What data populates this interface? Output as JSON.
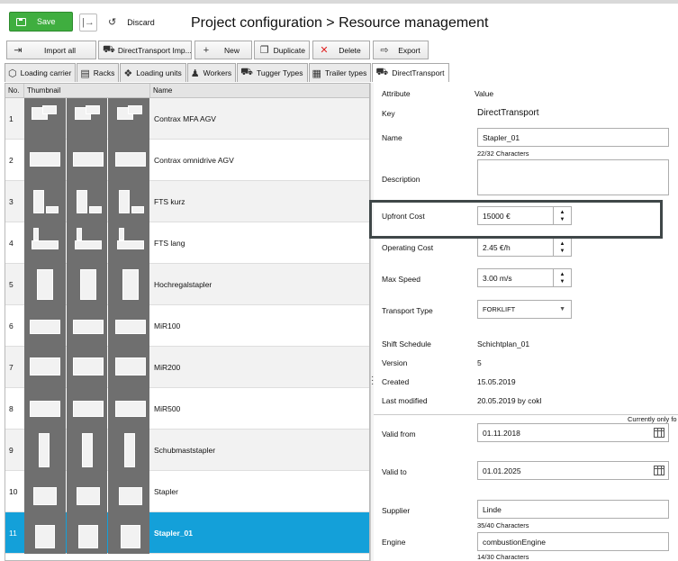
{
  "header": {
    "save_label": "Save",
    "discard_label": "Discard",
    "title": "Project configuration  >  Resource management"
  },
  "toolbar": {
    "import_all": "Import all",
    "direct_import": "DirectTransport Imp...",
    "new": "New",
    "duplicate": "Duplicate",
    "delete": "Delete",
    "export": "Export"
  },
  "tabs": [
    {
      "label": "Loading carrier"
    },
    {
      "label": "Racks"
    },
    {
      "label": "Loading units"
    },
    {
      "label": "Workers"
    },
    {
      "label": "Tugger Types"
    },
    {
      "label": "Trailer types"
    },
    {
      "label": "DirectTransport"
    }
  ],
  "table": {
    "col_no": "No.",
    "col_thumb": "Thumbnail",
    "col_name": "Name",
    "rows": [
      {
        "no": "1",
        "name": "Contrax MFA AGV"
      },
      {
        "no": "2",
        "name": "Contrax omnidrive AGV"
      },
      {
        "no": "3",
        "name": "FTS kurz"
      },
      {
        "no": "4",
        "name": "FTS lang"
      },
      {
        "no": "5",
        "name": "Hochregalstapler"
      },
      {
        "no": "6",
        "name": "MiR100"
      },
      {
        "no": "7",
        "name": "MiR200"
      },
      {
        "no": "8",
        "name": "MiR500"
      },
      {
        "no": "9",
        "name": "Schubmaststapler"
      },
      {
        "no": "10",
        "name": "Stapler"
      },
      {
        "no": "11",
        "name": "Stapler_01"
      }
    ],
    "selected_index": 10
  },
  "properties": {
    "col_attribute": "Attribute",
    "col_value": "Value",
    "key_label": "Key",
    "key_value": "DirectTransport",
    "name_label": "Name",
    "name_value": "Stapler_01",
    "name_counter": "22/32 Characters",
    "description_label": "Description",
    "description_value": "",
    "upfront_label": "Upfront Cost",
    "upfront_value": "15000 €",
    "operating_label": "Operating Cost",
    "operating_value": "2.45 €/h",
    "speed_label": "Max Speed",
    "speed_value": "3.00 m/s",
    "transport_label": "Transport Type",
    "transport_value": "FORKLIFT",
    "shift_label": "Shift Schedule",
    "shift_value": "Schichtplan_01",
    "version_label": "Version",
    "version_value": "5",
    "created_label": "Created",
    "created_value": "15.05.2019",
    "modified_label": "Last modified",
    "modified_value": "20.05.2019 by cokl",
    "note": "Currently only fo",
    "valid_from_label": "Valid from",
    "valid_from_value": "01.11.2018",
    "valid_to_label": "Valid to",
    "valid_to_value": "01.01.2025",
    "supplier_label": "Supplier",
    "supplier_value": "Linde",
    "supplier_counter": "35/40 Characters",
    "engine_label": "Engine",
    "engine_value": "combustionEngine",
    "engine_counter": "14/30 Characters"
  },
  "colors": {
    "save_green": "#3fae3f",
    "selection_blue": "#14a0d9",
    "highlight_border": "#3f4748"
  }
}
